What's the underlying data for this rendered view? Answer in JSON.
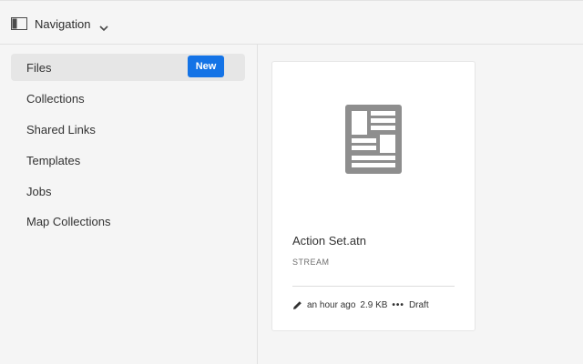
{
  "header": {
    "nav_label": "Navigation",
    "icon": "sidebar-panel-icon",
    "chevron": "chevron-down-icon"
  },
  "sidebar": {
    "items": [
      {
        "label": "Files",
        "active": true
      },
      {
        "label": "Collections"
      },
      {
        "label": "Shared Links"
      },
      {
        "label": "Templates"
      },
      {
        "label": "Jobs"
      },
      {
        "label": "Map Collections"
      }
    ]
  },
  "main": {
    "card": {
      "badge": "New",
      "thumbnail_icon": "document-layout-icon",
      "name": "Action Set.atn",
      "type": "STREAM",
      "edited_icon": "pencil-icon",
      "modified": "an hour ago",
      "size": "2.9 KB",
      "more": "•••",
      "status": "Draft"
    }
  },
  "colors": {
    "accent": "#1473e6",
    "sidebar_active": "#e6e6e6",
    "background": "#f5f5f5",
    "card": "#ffffff"
  }
}
